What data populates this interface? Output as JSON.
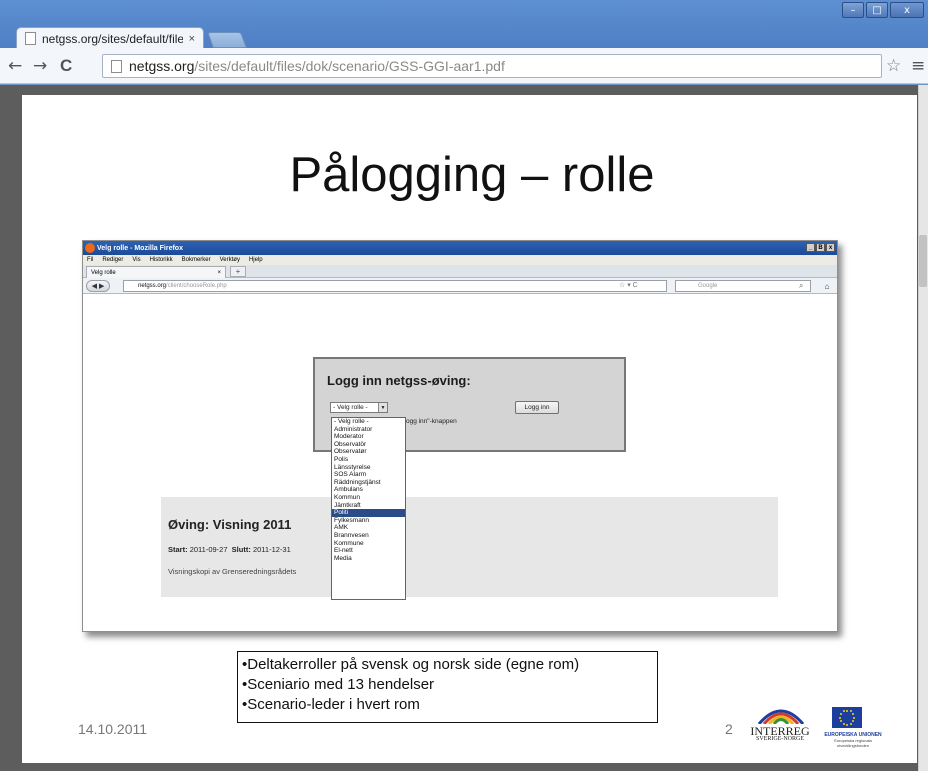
{
  "browser": {
    "tab_title": "netgss.org/sites/default/files",
    "tab_close": "×",
    "url_host": "netgss.org",
    "url_path": "/sites/default/files/dok/scenario/GSS-GGI-aar1.pdf",
    "window_buttons": {
      "minimize": "–",
      "maximize": "□",
      "close": "x"
    },
    "nav": {
      "back": "←",
      "forward": "→",
      "reload": "C"
    },
    "star": "☆",
    "menu": "≡"
  },
  "slide": {
    "title": "Pålogging – rolle",
    "bullets": [
      "•Deltakerroller på svensk og norsk side (egne rom)",
      "•Sceniario med 13 hendelser",
      "•Scenario-leder i hvert rom"
    ],
    "date": "14.10.2011",
    "page_number": "2",
    "logos": {
      "interreg": "INTERREG",
      "interreg_sub": "SVERIGE-NORGE",
      "eu": "EUROPEISKA UNIONEN",
      "eu_sub": "Europeiska regionala utvecklingsfonden"
    }
  },
  "firefox": {
    "window_title": "Velg rolle - Mozilla Firefox",
    "window_buttons": [
      "_",
      "B",
      "x"
    ],
    "menu": [
      "Fil",
      "Rediger",
      "Vis",
      "Historikk",
      "Bokmerker",
      "Verktøy",
      "Hjelp"
    ],
    "tab_title": "Velg rolle",
    "tab_close": "×",
    "new_tab": "+",
    "back": "◀ ▶",
    "url_host": "netgss.org",
    "url_path": "/client/chooseRole.php",
    "url_icons": "☆ ▾ C",
    "search_placeholder": "Google",
    "search_button": "⌕",
    "home": "⌂",
    "login_title": "Logg inn netgss-øving:",
    "select_value": "- Velg rolle -",
    "select_arrow": "▼",
    "login_button": "Logg inn",
    "hint": "på \"Logg inn\"-knappen",
    "exercise": {
      "title": "Øving: Visning 2011",
      "start_label": "Start:",
      "start_value": "2011-09-27",
      "end_label": "Slutt:",
      "end_value": "2011-12-31",
      "description": "Visningskopi av Grenseredningsrådets"
    },
    "roles": [
      "- Velg rolle -",
      "Administrator",
      "Moderator",
      "Observatör",
      "Observatør",
      "Polis",
      "Länsstyrelse",
      "SOS Alarm",
      "Räddningstjänst",
      "Ambulans",
      "Kommun",
      "Jämtkraft",
      "Politi",
      "Fylkesmann",
      "AMK",
      "Brannvesen",
      "Kommune",
      "El-nett",
      "Media"
    ],
    "selected_role_index": 12
  }
}
